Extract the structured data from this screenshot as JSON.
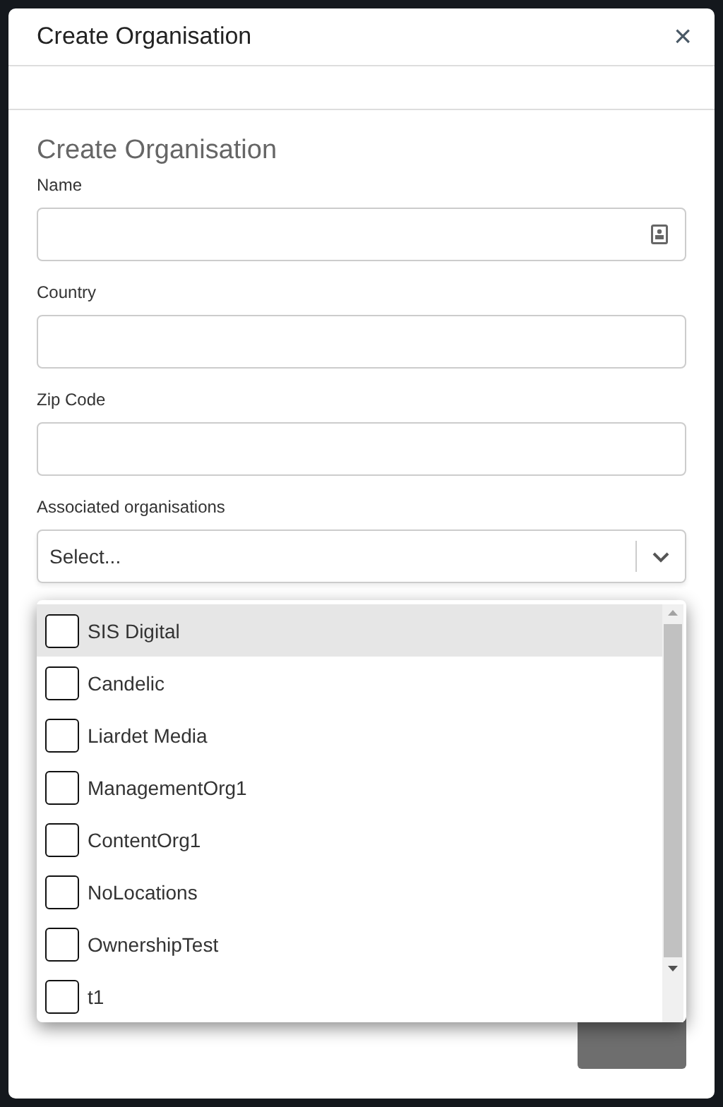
{
  "dialog": {
    "title": "Create Organisation",
    "close": "×"
  },
  "form": {
    "heading": "Create Organisation",
    "fields": [
      {
        "kind": "text",
        "label": "Name",
        "contact_icon": true
      },
      {
        "kind": "text",
        "label": "Country",
        "contact_icon": false
      },
      {
        "kind": "text",
        "label": "Zip Code",
        "contact_icon": false
      },
      {
        "kind": "select",
        "label": "Associated organisations",
        "placeholder": "Select..."
      }
    ]
  },
  "dropdown": {
    "options": [
      {
        "label": "SIS Digital",
        "highlighted": true,
        "checked": false
      },
      {
        "label": "Candelic",
        "highlighted": false,
        "checked": false
      },
      {
        "label": "Liardet Media",
        "highlighted": false,
        "checked": false
      },
      {
        "label": "ManagementOrg1",
        "highlighted": false,
        "checked": false
      },
      {
        "label": "ContentOrg1",
        "highlighted": false,
        "checked": false
      },
      {
        "label": "NoLocations",
        "highlighted": false,
        "checked": false
      },
      {
        "label": "OwnershipTest",
        "highlighted": false,
        "checked": false
      },
      {
        "label": "t1",
        "highlighted": false,
        "checked": false
      }
    ]
  },
  "save_button": {
    "disabled": true
  }
}
